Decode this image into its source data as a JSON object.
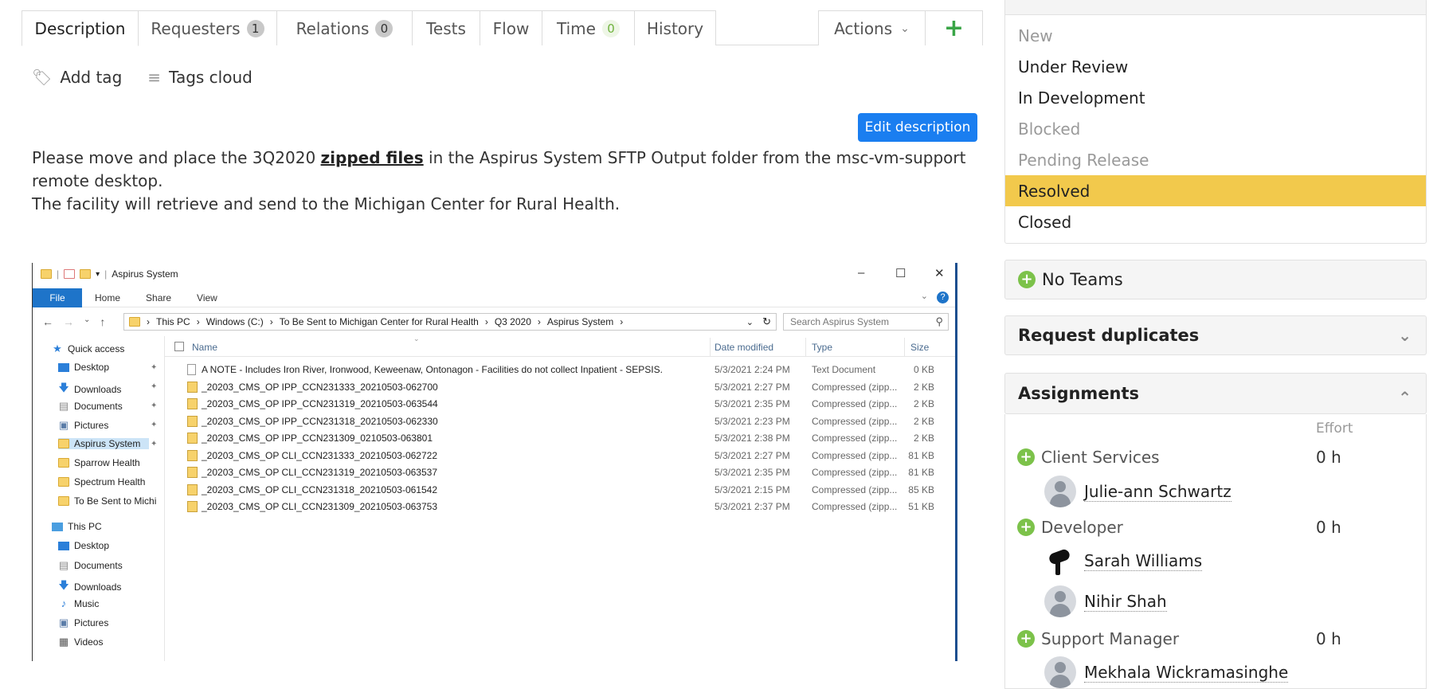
{
  "tabs": [
    {
      "label": "Description"
    },
    {
      "label": "Requesters",
      "count": "1"
    },
    {
      "label": "Relations",
      "count": "0"
    },
    {
      "label": "Tests"
    },
    {
      "label": "Flow"
    },
    {
      "label": "Time",
      "count": "0"
    },
    {
      "label": "History"
    }
  ],
  "toolbar": {
    "actions_label": "Actions",
    "add_label": "+"
  },
  "tags": {
    "add_tag": "Add tag",
    "tags_cloud": "Tags cloud"
  },
  "edit_description": "Edit description",
  "description": {
    "line1_pre": "Please move and place the 3Q2020 ",
    "line1_link": "zipped files",
    "line1_post": " in the Aspirus System SFTP Output folder from the msc-vm-support remote desktop.",
    "line2": "The facility will retrieve and send to the Michigan Center for Rural Health."
  },
  "explorer": {
    "title": "Aspirus System",
    "ribbon": [
      "File",
      "Home",
      "Share",
      "View"
    ],
    "path": [
      "This PC",
      "Windows (C:)",
      "To Be Sent to Michigan Center for Rural Health",
      "Q3 2020",
      "Aspirus System"
    ],
    "search_placeholder": "Search Aspirus System",
    "sidebar": [
      {
        "label": "Quick access"
      },
      {
        "label": "Desktop"
      },
      {
        "label": "Downloads"
      },
      {
        "label": "Documents"
      },
      {
        "label": "Pictures"
      },
      {
        "label": "Aspirus System"
      },
      {
        "label": "Sparrow Health"
      },
      {
        "label": "Spectrum Health"
      },
      {
        "label": "To Be Sent to Michi"
      },
      {
        "label": "This PC"
      },
      {
        "label": "Desktop"
      },
      {
        "label": "Documents"
      },
      {
        "label": "Downloads"
      },
      {
        "label": "Music"
      },
      {
        "label": "Pictures"
      },
      {
        "label": "Videos"
      }
    ],
    "columns": [
      "Name",
      "Date modified",
      "Type",
      "Size"
    ],
    "files": [
      {
        "name": "A NOTE - Includes Iron River, Ironwood, Keweenaw, Ontonagon - Facilities do not collect Inpatient - SEPSIS.",
        "date": "5/3/2021 2:24 PM",
        "type": "Text Document",
        "size": "0 KB"
      },
      {
        "name": "_20203_CMS_OP IPP_CCN231333_20210503-062700",
        "date": "5/3/2021 2:27 PM",
        "type": "Compressed (zipp...",
        "size": "2 KB"
      },
      {
        "name": "_20203_CMS_OP IPP_CCN231319_20210503-063544",
        "date": "5/3/2021 2:35 PM",
        "type": "Compressed (zipp...",
        "size": "2 KB"
      },
      {
        "name": "_20203_CMS_OP IPP_CCN231318_20210503-062330",
        "date": "5/3/2021 2:23 PM",
        "type": "Compressed (zipp...",
        "size": "2 KB"
      },
      {
        "name": "_20203_CMS_OP IPP_CCN231309_0210503-063801",
        "date": "5/3/2021 2:38 PM",
        "type": "Compressed (zipp...",
        "size": "2 KB"
      },
      {
        "name": "_20203_CMS_OP CLI_CCN231333_20210503-062722",
        "date": "5/3/2021 2:27 PM",
        "type": "Compressed (zipp...",
        "size": "81 KB"
      },
      {
        "name": "_20203_CMS_OP CLI_CCN231319_20210503-063537",
        "date": "5/3/2021 2:35 PM",
        "type": "Compressed (zipp...",
        "size": "81 KB"
      },
      {
        "name": "_20203_CMS_OP CLI_CCN231318_20210503-061542",
        "date": "5/3/2021 2:15 PM",
        "type": "Compressed (zipp...",
        "size": "85 KB"
      },
      {
        "name": "_20203_CMS_OP CLI_CCN231309_20210503-063753",
        "date": "5/3/2021 2:37 PM",
        "type": "Compressed (zipp...",
        "size": "51 KB"
      }
    ]
  },
  "status": {
    "items": [
      {
        "label": "New",
        "state": "muted"
      },
      {
        "label": "Under Review",
        "state": "normal"
      },
      {
        "label": "In Development",
        "state": "normal"
      },
      {
        "label": "Blocked",
        "state": "muted"
      },
      {
        "label": "Pending Release",
        "state": "muted"
      },
      {
        "label": "Resolved",
        "state": "active"
      },
      {
        "label": "Closed",
        "state": "normal"
      }
    ],
    "active_color": "#f2c94c"
  },
  "panels": {
    "teams": "No Teams",
    "duplicates": "Request duplicates",
    "assignments": "Assignments"
  },
  "assignments": {
    "effort_header": "Effort",
    "groups": [
      {
        "role": "Client Services",
        "effort": "0 h",
        "people": [
          "Julie-ann Schwartz"
        ]
      },
      {
        "role": "Developer",
        "effort": "0 h",
        "people": [
          "Sarah Williams",
          "Nihir Shah"
        ]
      },
      {
        "role": "Support Manager",
        "effort": "0 h",
        "people": [
          "Mekhala Wickramasinghe"
        ]
      }
    ]
  }
}
